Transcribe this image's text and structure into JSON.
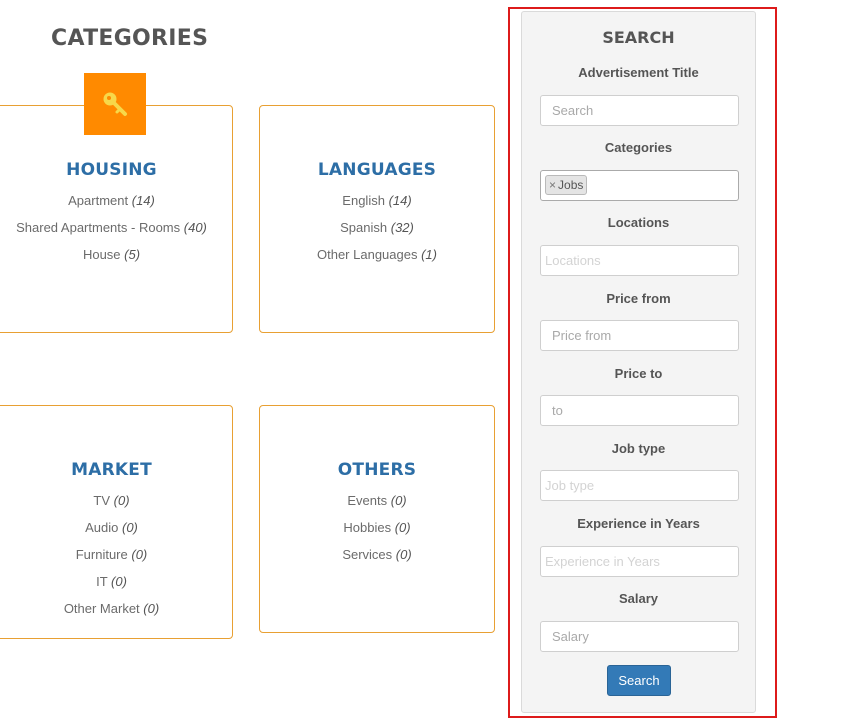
{
  "categories_heading": "CATEGORIES",
  "categories": [
    {
      "title": "HOUSING",
      "items": [
        {
          "label": "Apartment",
          "count": "(14)"
        },
        {
          "label": "Shared Apartments - Rooms",
          "count": "(40)"
        },
        {
          "label": "House",
          "count": "(5)"
        }
      ]
    },
    {
      "title": "LANGUAGES",
      "items": [
        {
          "label": "English",
          "count": "(14)"
        },
        {
          "label": "Spanish",
          "count": "(32)"
        },
        {
          "label": "Other Languages",
          "count": "(1)"
        }
      ]
    },
    {
      "title": "MARKET",
      "items": [
        {
          "label": "TV",
          "count": "(0)"
        },
        {
          "label": "Audio",
          "count": "(0)"
        },
        {
          "label": "Furniture",
          "count": "(0)"
        },
        {
          "label": "IT",
          "count": "(0)"
        },
        {
          "label": "Other Market",
          "count": "(0)"
        }
      ]
    },
    {
      "title": "OTHERS",
      "items": [
        {
          "label": "Events",
          "count": "(0)"
        },
        {
          "label": "Hobbies",
          "count": "(0)"
        },
        {
          "label": "Services",
          "count": "(0)"
        }
      ]
    }
  ],
  "housing_icon": "key-icon",
  "accent_color": "#ff8a00",
  "card_border_color": "#e8a033",
  "search": {
    "title": "SEARCH",
    "ad_title_label": "Advertisement Title",
    "ad_title_placeholder": "Search",
    "categories_label": "Categories",
    "selected_category": "Jobs",
    "tag_remove": "×",
    "locations_label": "Locations",
    "locations_placeholder": "Locations",
    "price_from_label": "Price from",
    "price_from_placeholder": "Price from",
    "price_to_label": "Price to",
    "price_to_placeholder": "to",
    "job_type_label": "Job type",
    "job_type_placeholder": "Job type",
    "experience_label": "Experience in Years",
    "experience_placeholder": "Experience in Years",
    "salary_label": "Salary",
    "salary_placeholder": "Salary",
    "button_label": "Search",
    "button_color": "#337ab7"
  }
}
